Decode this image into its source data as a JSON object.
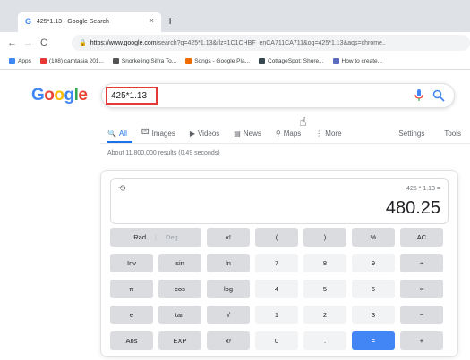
{
  "browser": {
    "tab_title": "425*1.13 - Google Search",
    "tab_close": "×",
    "new_tab": "+",
    "nav": {
      "back": "←",
      "forward": "→",
      "reload": "C"
    },
    "url_host": "https://www.google.com",
    "url_path": "/search?q=425*1.13&rlz=1C1CHBF_enCA711CA711&oq=425*1.13&aqs=chrome..",
    "bookmarks": [
      {
        "label": "Apps",
        "color": "#4285f4"
      },
      {
        "label": "(108) camtasia 201...",
        "color": "#e53935"
      },
      {
        "label": "Snorkeling Silfra To...",
        "color": "#555555"
      },
      {
        "label": "Songs - Google Pla...",
        "color": "#ef6c00"
      },
      {
        "label": "CottageSpot: Shore...",
        "color": "#37474f"
      },
      {
        "label": "How to create...",
        "color": "#5c6bc0"
      }
    ]
  },
  "google": {
    "logo": [
      {
        "ch": "G",
        "color": "#4285f4"
      },
      {
        "ch": "o",
        "color": "#ea4335"
      },
      {
        "ch": "o",
        "color": "#fbbc05"
      },
      {
        "ch": "g",
        "color": "#4285f4"
      },
      {
        "ch": "l",
        "color": "#34a853"
      },
      {
        "ch": "e",
        "color": "#ea4335"
      }
    ],
    "query": "425*1.13",
    "tabs": [
      {
        "label": "All",
        "icon": "🔍"
      },
      {
        "label": "Images",
        "icon": "🖾"
      },
      {
        "label": "Videos",
        "icon": "▶"
      },
      {
        "label": "News",
        "icon": "▤"
      },
      {
        "label": "Maps",
        "icon": "⚲"
      },
      {
        "label": "More",
        "icon": "⋮"
      }
    ],
    "settings": "Settings",
    "tools": "Tools",
    "result_stats": "About 11,800,000 results (0.49 seconds)"
  },
  "calculator": {
    "expression": "425 * 1.13 =",
    "result": "480.25",
    "rows": [
      [
        "Rad|Deg",
        "x!",
        "(",
        ")",
        "%",
        "AC"
      ],
      [
        "Inv",
        "sin",
        "ln",
        "7",
        "8",
        "9",
        "÷"
      ],
      [
        "π",
        "cos",
        "log",
        "4",
        "5",
        "6",
        "×"
      ],
      [
        "e",
        "tan",
        "√",
        "1",
        "2",
        "3",
        "−"
      ],
      [
        "Ans",
        "EXP",
        "xʸ",
        "0",
        ".",
        "=",
        "+"
      ]
    ]
  }
}
